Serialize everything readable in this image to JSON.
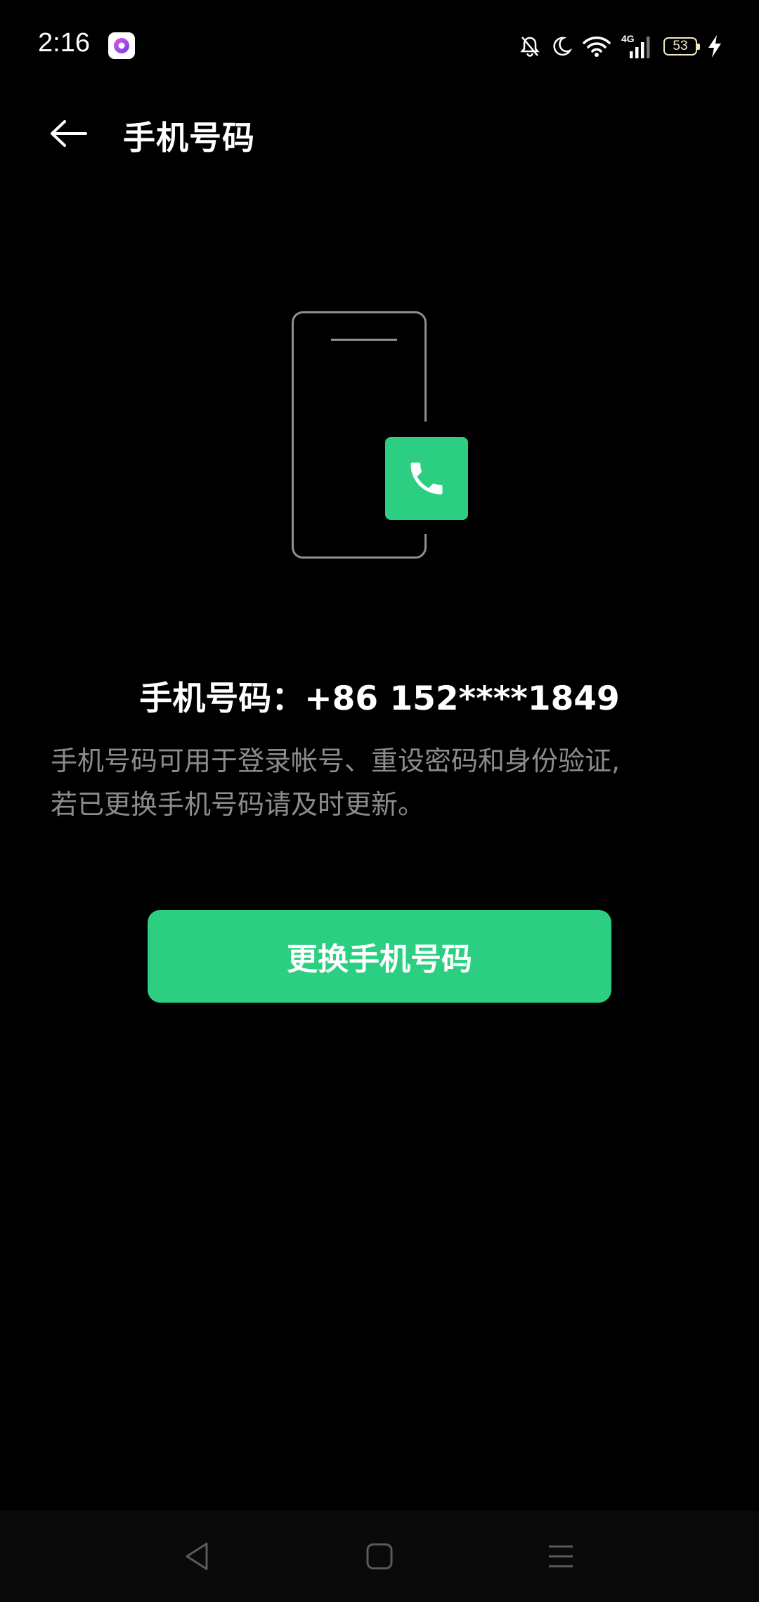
{
  "status_bar": {
    "time": "2:16",
    "battery_level": "53",
    "network": "4G",
    "icons": [
      "app-notification-icon",
      "mute-bell-icon",
      "moon-icon",
      "wifi-icon",
      "signal-icon",
      "battery-icon",
      "charging-bolt-icon"
    ]
  },
  "header": {
    "title": "手机号码",
    "back_icon": "back-arrow-icon"
  },
  "illustration": {
    "icon": "phone-call-icon",
    "accent_color": "#2ccf82"
  },
  "content": {
    "phone_line": "手机号码：+86 152****1849",
    "description_line1": "手机号码可用于登录帐号、重设密码和身份验证,",
    "description_line2": "若已更换手机号码请及时更新。"
  },
  "actions": {
    "change_label": "更换手机号码",
    "button_color": "#2ccf82"
  },
  "nav_bar": {
    "icons": [
      "nav-back-icon",
      "nav-home-icon",
      "nav-recents-icon"
    ]
  }
}
